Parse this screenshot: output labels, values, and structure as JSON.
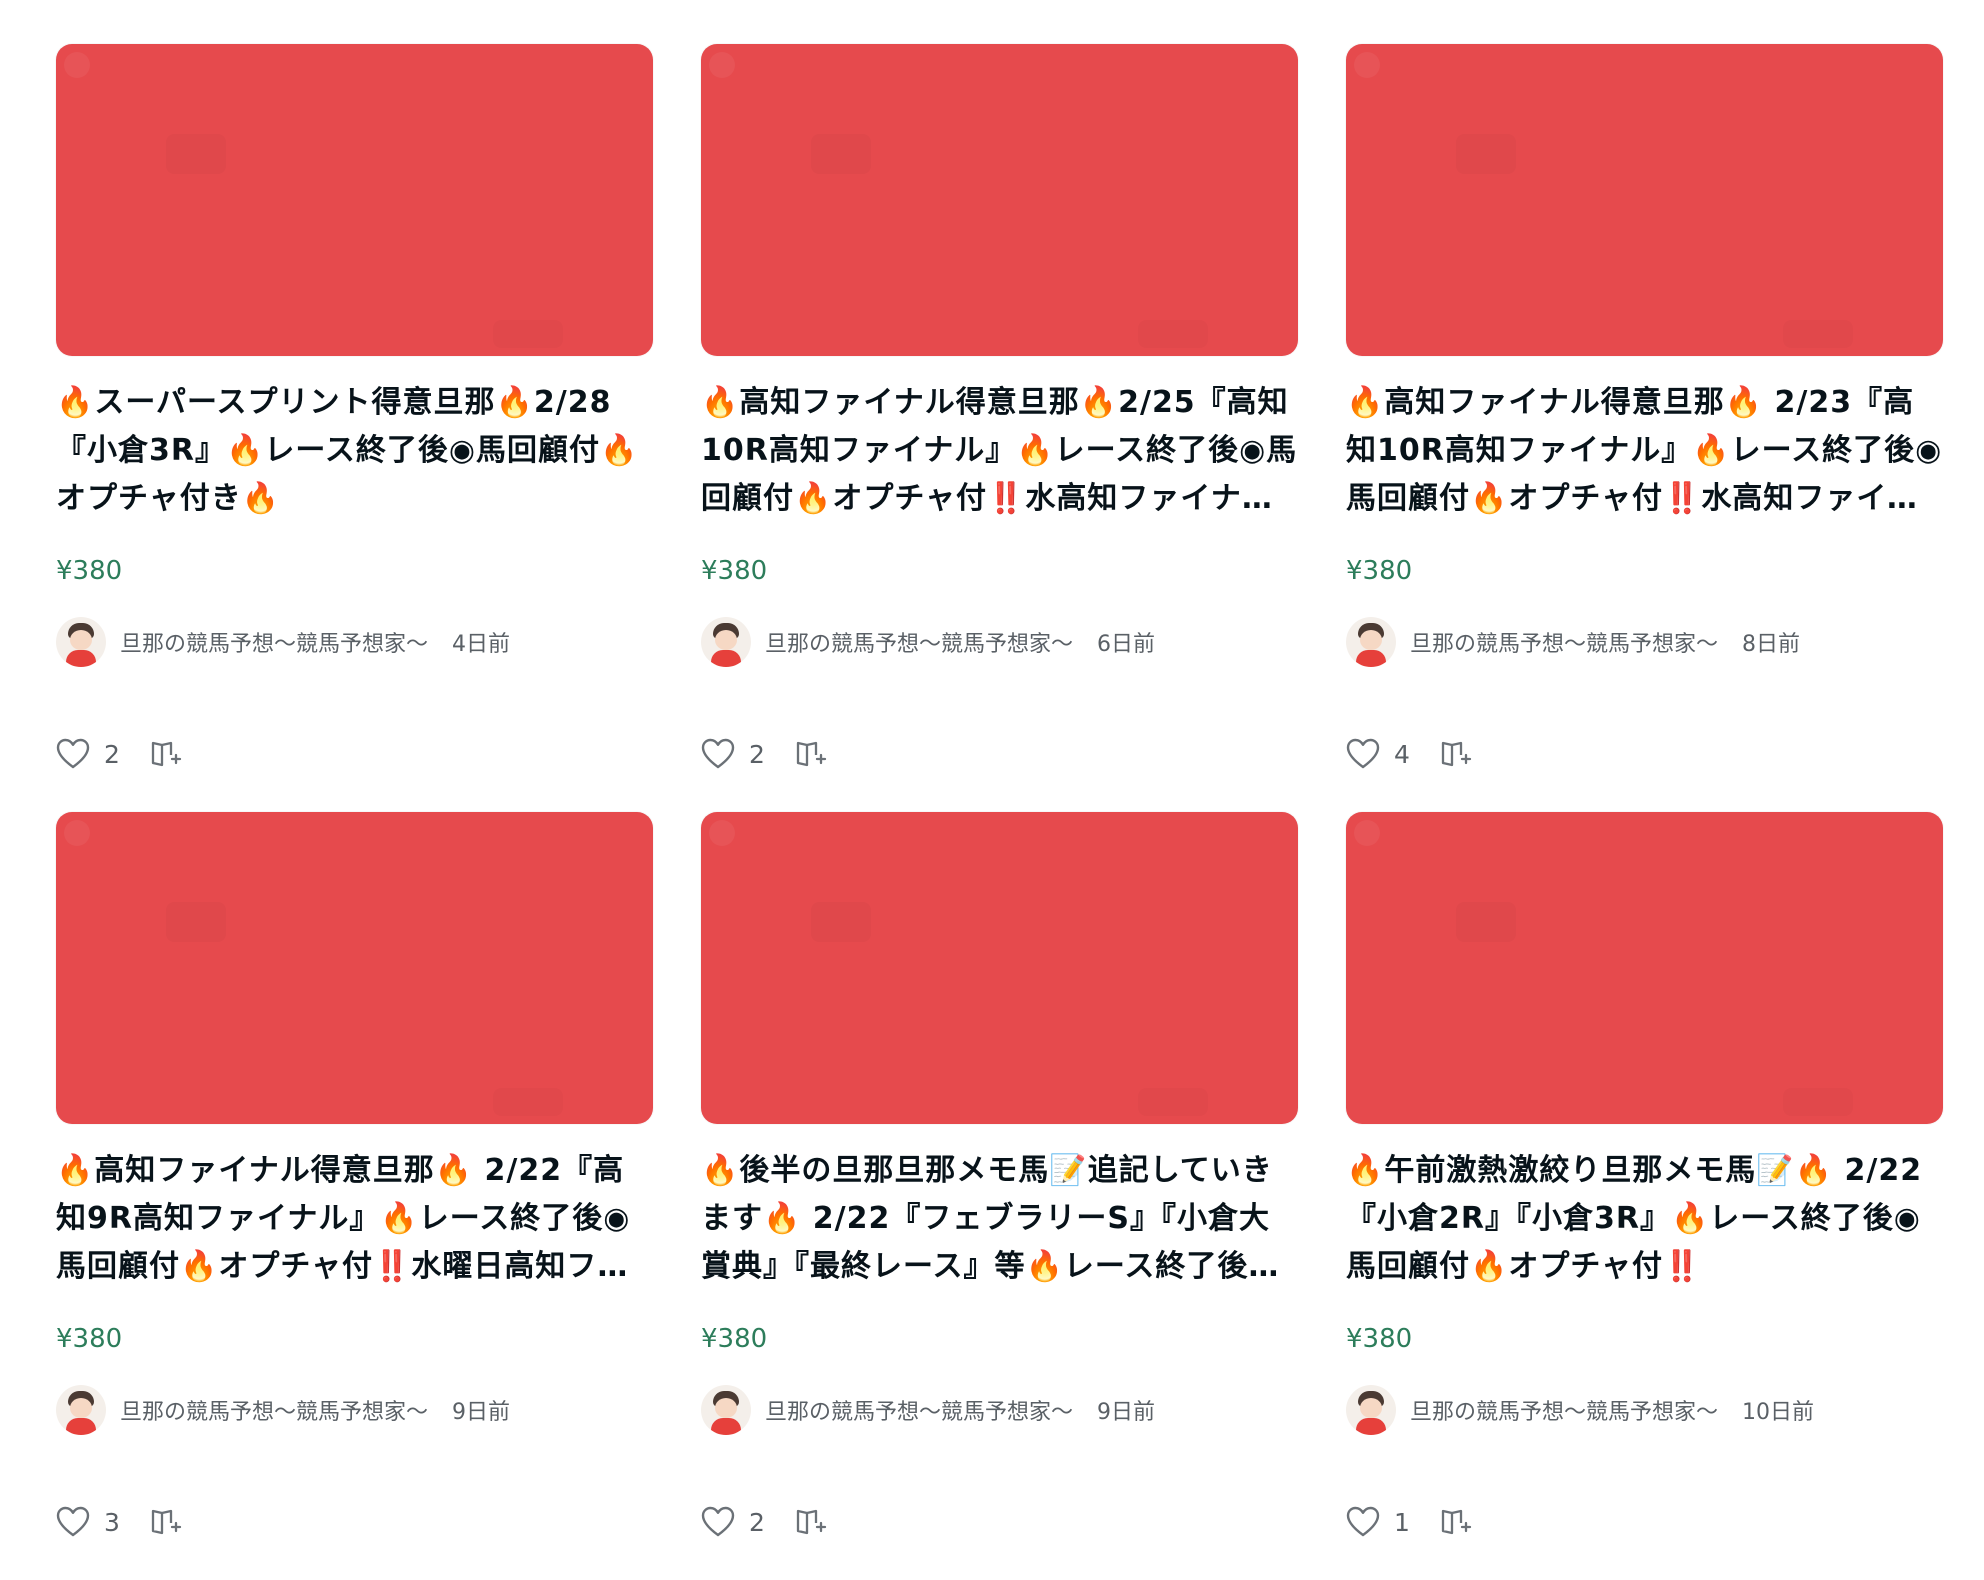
{
  "cards": [
    {
      "title": "🔥スーパースプリント得意旦那🔥2/28『小倉3R』🔥レース終了後◉馬回顧付🔥オプチャ付き🔥",
      "price": "¥380",
      "author": "旦那の競馬予想〜競馬予想家〜",
      "time": "4日前",
      "likes": "2"
    },
    {
      "title": "🔥高知ファイナル得意旦那🔥2/25『高知10R高知ファイナル』🔥レース終了後◉馬回顧付🔥オプチャ付‼️水高知ファイナル…",
      "price": "¥380",
      "author": "旦那の競馬予想〜競馬予想家〜",
      "time": "6日前",
      "likes": "2"
    },
    {
      "title": "🔥高知ファイナル得意旦那🔥 2/23『高知10R高知ファイナル』🔥レース終了後◉馬回顧付🔥オプチャ付‼️水高知ファイナル…",
      "price": "¥380",
      "author": "旦那の競馬予想〜競馬予想家〜",
      "time": "8日前",
      "likes": "4"
    },
    {
      "title": "🔥高知ファイナル得意旦那🔥 2/22『高知9R高知ファイナル』🔥レース終了後◉馬回顧付🔥オプチャ付‼️水曜日高知ファイナル…",
      "price": "¥380",
      "author": "旦那の競馬予想〜競馬予想家〜",
      "time": "9日前",
      "likes": "3"
    },
    {
      "title": "🔥後半の旦那旦那メモ馬📝追記していきます🔥 2/22『フェブラリーS』『小倉大賞典』『最終レース』等🔥レース終了後◉馬回顧…",
      "price": "¥380",
      "author": "旦那の競馬予想〜競馬予想家〜",
      "time": "9日前",
      "likes": "2"
    },
    {
      "title": "🔥午前激熱激絞り旦那メモ馬📝🔥 2/22『小倉2R』『小倉3R』🔥レース終了後◉馬回顧付🔥オプチャ付‼️",
      "price": "¥380",
      "author": "旦那の競馬予想〜競馬予想家〜",
      "time": "10日前",
      "likes": "1"
    }
  ],
  "icons": {
    "like": "heart-outline-icon",
    "magazine": "magazine-add-icon"
  },
  "colors": {
    "thumbnail": "#e64a4d",
    "price": "#2d7d5b",
    "meta_text": "#5a6066",
    "title_text": "#08131a"
  }
}
